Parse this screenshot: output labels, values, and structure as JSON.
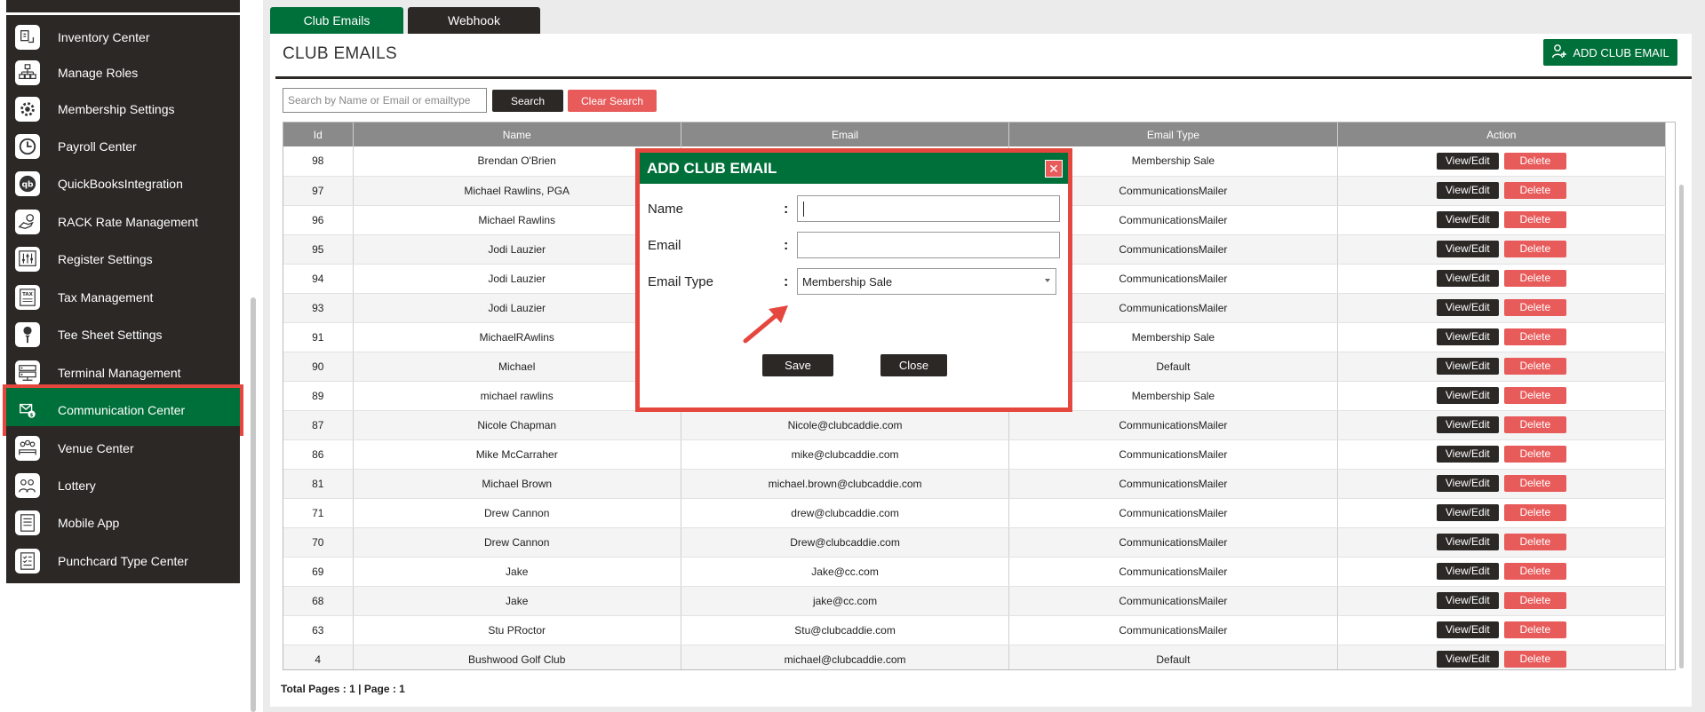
{
  "sidebar": {
    "items": [
      {
        "label": "Inventory Center",
        "icon": "inventory-icon"
      },
      {
        "label": "Manage Roles",
        "icon": "roles-icon"
      },
      {
        "label": "Membership Settings",
        "icon": "gear-icon"
      },
      {
        "label": "Payroll Center",
        "icon": "clock-icon"
      },
      {
        "label": "QuickBooksIntegration",
        "icon": "quickbooks-icon"
      },
      {
        "label": "RACK Rate Management",
        "icon": "hand-coin-icon"
      },
      {
        "label": "Register Settings",
        "icon": "sliders-icon"
      },
      {
        "label": "Tax Management",
        "icon": "tax-icon"
      },
      {
        "label": "Tee Sheet Settings",
        "icon": "golf-tee-icon"
      },
      {
        "label": "Terminal Management",
        "icon": "terminal-icon"
      },
      {
        "label": "Communication Center",
        "icon": "communication-icon"
      },
      {
        "label": "Venue Center",
        "icon": "venue-icon"
      },
      {
        "label": "Lottery",
        "icon": "lottery-icon"
      },
      {
        "label": "Mobile App",
        "icon": "mobile-icon"
      },
      {
        "label": "Punchcard Type Center",
        "icon": "punchcard-icon"
      }
    ],
    "active": "Communication Center"
  },
  "tabs": [
    {
      "label": "Club Emails",
      "active": true
    },
    {
      "label": "Webhook",
      "active": false
    }
  ],
  "page": {
    "title": "CLUB EMAILS",
    "add_button": "ADD CLUB EMAIL"
  },
  "search": {
    "placeholder": "Search by Name or Email or emailtype",
    "search_label": "Search",
    "clear_label": "Clear Search"
  },
  "table": {
    "headers": [
      "Id",
      "Name",
      "Email",
      "Email Type",
      "Action"
    ],
    "view_label": "View/Edit",
    "delete_label": "Delete",
    "rows": [
      [
        "98",
        "Brendan O'Brien",
        "",
        "Membership Sale"
      ],
      [
        "97",
        "Michael Rawlins, PGA",
        "",
        "CommunicationsMailer"
      ],
      [
        "96",
        "Michael Rawlins",
        "",
        "CommunicationsMailer"
      ],
      [
        "95",
        "Jodi Lauzier",
        "",
        "CommunicationsMailer"
      ],
      [
        "94",
        "Jodi Lauzier",
        "",
        "CommunicationsMailer"
      ],
      [
        "93",
        "Jodi Lauzier",
        "",
        "CommunicationsMailer"
      ],
      [
        "91",
        "MichaelRAwlins",
        "",
        "Membership Sale"
      ],
      [
        "90",
        "Michael",
        "",
        "Default"
      ],
      [
        "89",
        "michael rawlins",
        "",
        "Membership Sale"
      ],
      [
        "87",
        "Nicole Chapman",
        "Nicole@clubcaddie.com",
        "CommunicationsMailer"
      ],
      [
        "86",
        "Mike McCarraher",
        "mike@clubcaddie.com",
        "CommunicationsMailer"
      ],
      [
        "81",
        "Michael Brown",
        "michael.brown@clubcaddie.com",
        "CommunicationsMailer"
      ],
      [
        "71",
        "Drew Cannon",
        "drew@clubcaddie.com",
        "CommunicationsMailer"
      ],
      [
        "70",
        "Drew Cannon",
        "Drew@clubcaddie.com",
        "CommunicationsMailer"
      ],
      [
        "69",
        "Jake",
        "Jake@cc.com",
        "CommunicationsMailer"
      ],
      [
        "68",
        "Jake",
        "jake@cc.com",
        "CommunicationsMailer"
      ],
      [
        "63",
        "Stu PRoctor",
        "Stu@clubcaddie.com",
        "CommunicationsMailer"
      ],
      [
        "4",
        "Bushwood Golf Club",
        "michael@clubcaddie.com",
        "Default"
      ]
    ]
  },
  "footer": {
    "pages": "Total Pages : 1 | Page : 1"
  },
  "modal": {
    "title": "ADD CLUB EMAIL",
    "name_label": "Name",
    "email_label": "Email",
    "type_label": "Email Type",
    "colon": ":",
    "name_value": "",
    "email_value": "",
    "type_value": "Membership Sale",
    "save_label": "Save",
    "close_label": "Close"
  },
  "colors": {
    "brand_green": "#00703a",
    "dark": "#2b2826",
    "danger": "#e85b5b",
    "highlight": "#e5473f"
  }
}
